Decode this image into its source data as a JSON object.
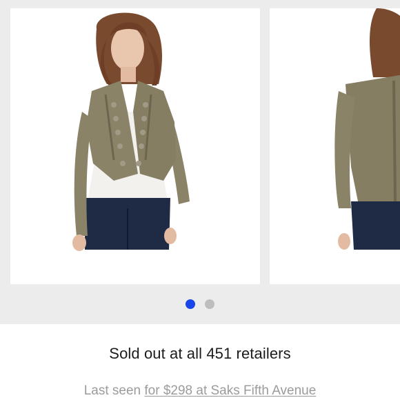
{
  "carousel": {
    "images": [
      {
        "alt_icon": "jacket-front-photo"
      },
      {
        "alt_icon": "jacket-back-photo"
      }
    ],
    "active_index": 0,
    "dot_colors": {
      "active": "#1846e8",
      "inactive": "#bdbdbd"
    }
  },
  "product": {
    "status_text": "Sold out at all 451 retailers",
    "last_seen_prefix": "Last seen ",
    "last_seen_link": "for $298 at Saks Fifth Avenue"
  },
  "colors": {
    "background": "#ececec",
    "card": "#ffffff",
    "jacket": "#8a8367",
    "text": "#1c1c1c",
    "muted": "#9b9b9b"
  }
}
